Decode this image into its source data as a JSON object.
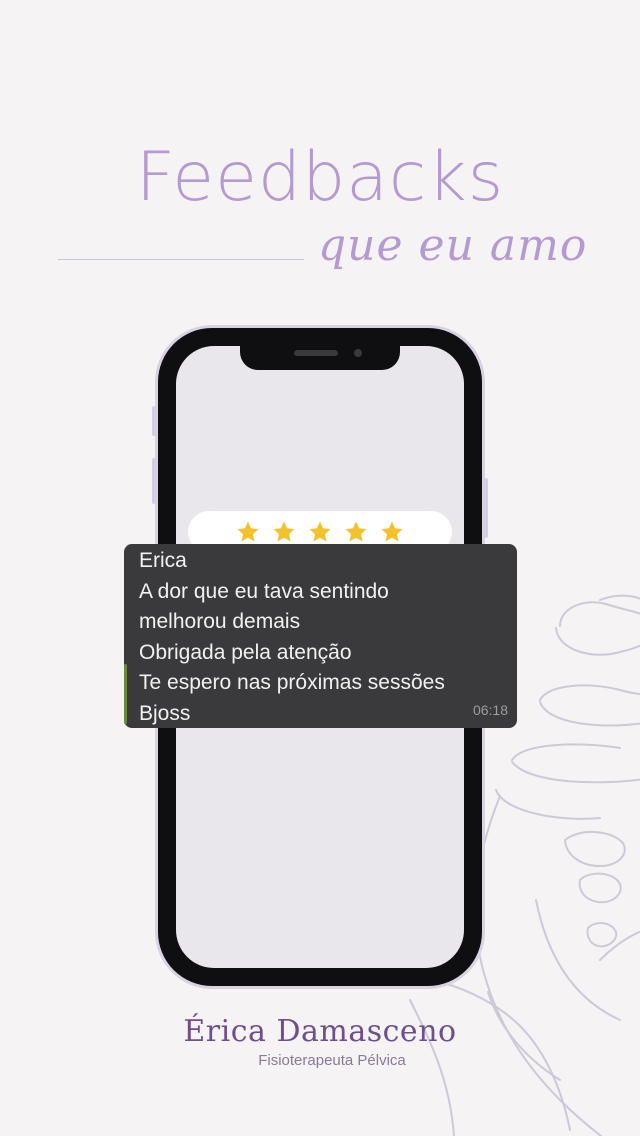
{
  "header": {
    "title": "Feedbacks",
    "subtitle": "que eu amo"
  },
  "rating": {
    "stars": 5,
    "star_color": "#f3c22b"
  },
  "message": {
    "sender": "Erica",
    "lines": [
      "A dor que eu tava sentindo",
      "melhorou demais",
      "Obrigada pela atenção",
      "Te espero nas próximas sessões",
      "Bjoss"
    ],
    "time": "06:18"
  },
  "brand": {
    "name": "Érica Damasceno",
    "tagline": "Fisioterapeuta Pélvica"
  },
  "colors": {
    "background": "#f5f3f4",
    "accent": "#b39ad0",
    "brand": "#6e4f8c",
    "bubble": "#3a3a3c"
  },
  "icons": {
    "star": "star-icon",
    "pelvis": "pelvis-outline-illustration"
  }
}
